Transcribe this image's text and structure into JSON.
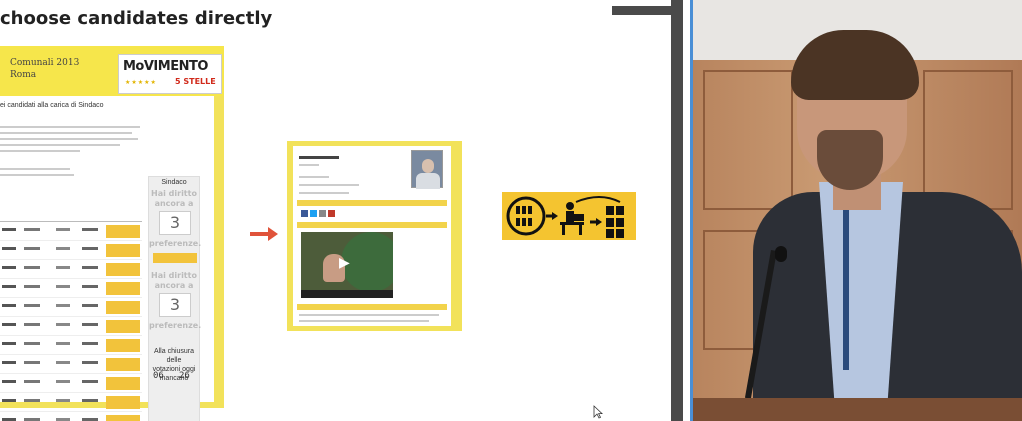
{
  "slide": {
    "title": "choose candidates directly"
  },
  "webpage": {
    "header": {
      "line1": "Comunali 2013",
      "line2": "Roma"
    },
    "logo": {
      "movimento": "MoVIMENTO",
      "cinque_stelle": "5 STELLE"
    },
    "section_heading": "ei candidati alla carica di Sindaco",
    "sidebar": {
      "label_top": "Sindaco",
      "hai_diritto_1": "Hai diritto\nancora a",
      "count_1": "3",
      "preferenze_1": "preferenze.",
      "hai_diritto_2": "Hai diritto\nancora a",
      "count_2": "3",
      "preferenze_2": "preferenze.",
      "closing_note": "Alla chiusura delle\nvotazioni oggi mancano",
      "countdown_a": "06",
      "countdown_b": "26"
    }
  },
  "icons": {
    "arrow": "arrow-right-icon",
    "infographic": "voting-process-icon"
  },
  "colors": {
    "m5s_yellow": "#f2e25a",
    "button_yellow": "#f2c33b",
    "arrow_red": "#e0533a",
    "presenter_accent": "#4a8fd6"
  }
}
